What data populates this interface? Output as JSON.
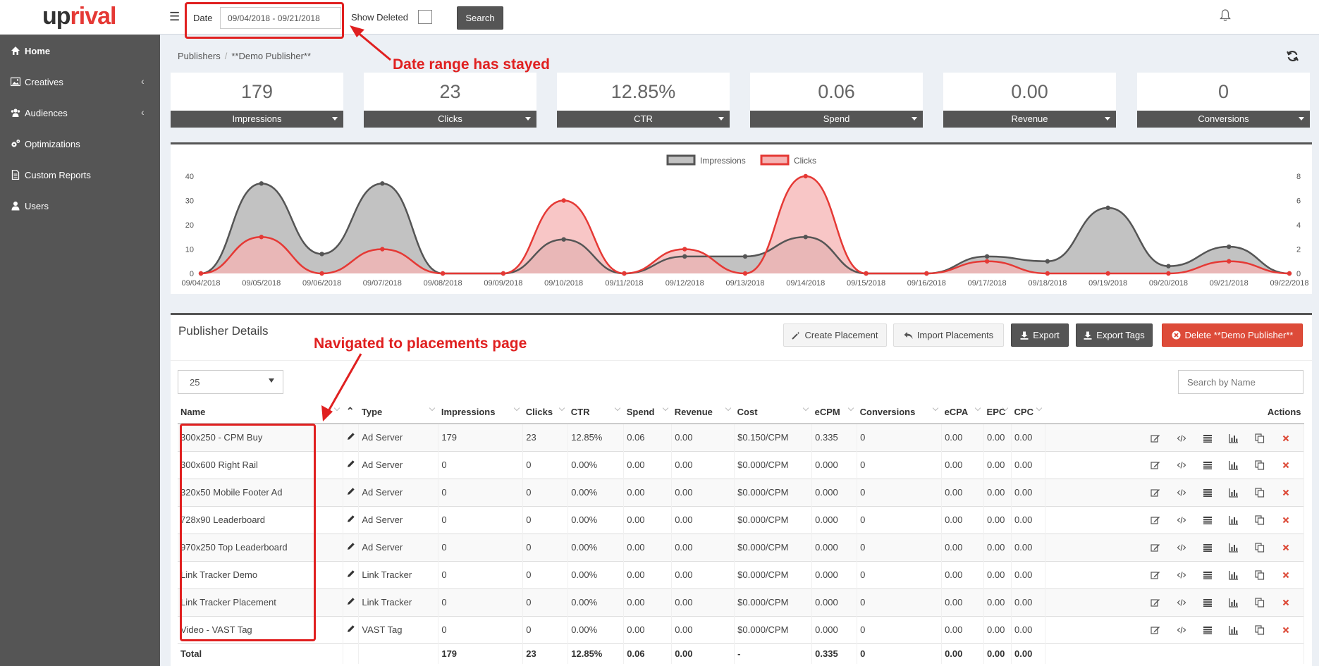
{
  "brand": {
    "logo_up": "up",
    "logo_rival": "rival"
  },
  "toolbar": {
    "date_label": "Date",
    "date_value": "09/04/2018 - 09/21/2018",
    "show_deleted_label": "Show Deleted",
    "search_label": "Search"
  },
  "annotations": {
    "date_note": "Date range has stayed",
    "nav_note": "Navigated to placements page"
  },
  "sidebar": {
    "items": [
      {
        "label": "Home",
        "icon": "home-icon",
        "has_chevron": false
      },
      {
        "label": "Creatives",
        "icon": "image-icon",
        "has_chevron": true
      },
      {
        "label": "Audiences",
        "icon": "users-icon",
        "has_chevron": true
      },
      {
        "label": "Optimizations",
        "icon": "gears-icon",
        "has_chevron": false
      },
      {
        "label": "Custom Reports",
        "icon": "file-icon",
        "has_chevron": false
      },
      {
        "label": "Users",
        "icon": "user-icon",
        "has_chevron": false
      }
    ]
  },
  "breadcrumb": {
    "root": "Publishers",
    "current": "**Demo Publisher**"
  },
  "stats": [
    {
      "value": "179",
      "label": "Impressions"
    },
    {
      "value": "23",
      "label": "Clicks"
    },
    {
      "value": "12.85%",
      "label": "CTR"
    },
    {
      "value": "0.06",
      "label": "Spend"
    },
    {
      "value": "0.00",
      "label": "Revenue"
    },
    {
      "value": "0",
      "label": "Conversions"
    }
  ],
  "chart_data": {
    "type": "area",
    "categories": [
      "09/04/2018",
      "09/05/2018",
      "09/06/2018",
      "09/07/2018",
      "09/08/2018",
      "09/09/2018",
      "09/10/2018",
      "09/11/2018",
      "09/12/2018",
      "09/13/2018",
      "09/14/2018",
      "09/15/2018",
      "09/16/2018",
      "09/17/2018",
      "09/18/2018",
      "09/19/2018",
      "09/20/2018",
      "09/21/2018",
      "09/22/2018"
    ],
    "series": [
      {
        "name": "Impressions",
        "axis": "left",
        "color": "#555555",
        "fill": "#c2c2c2",
        "values": [
          0,
          37,
          8,
          37,
          0,
          0,
          14,
          0,
          7,
          7,
          15,
          0,
          0,
          7,
          5,
          27,
          3,
          11,
          0
        ]
      },
      {
        "name": "Clicks",
        "axis": "right",
        "color": "#e53935",
        "fill": "#f5b3b3",
        "values": [
          0,
          3,
          0,
          2,
          0,
          0,
          6,
          0,
          2,
          0,
          8,
          0,
          0,
          1,
          0,
          0,
          0,
          1,
          0
        ]
      }
    ],
    "y_left": {
      "ticks": [
        0,
        10,
        20,
        30,
        40
      ],
      "ylim": [
        0,
        40
      ]
    },
    "y_right": {
      "ticks": [
        0,
        2,
        4,
        6,
        8
      ],
      "ylim": [
        0,
        8
      ]
    },
    "legend": "top-center"
  },
  "details": {
    "title": "Publisher Details",
    "buttons": {
      "create": "Create Placement",
      "import": "Import Placements",
      "export": "Export",
      "export_tags": "Export Tags",
      "delete": "Delete **Demo Publisher**"
    },
    "page_size": "25",
    "search_placeholder": "Search by Name",
    "columns": [
      "Name",
      "",
      "Type",
      "Impressions",
      "Clicks",
      "CTR",
      "Spend",
      "Revenue",
      "Cost",
      "eCPM",
      "Conversions",
      "eCPA",
      "EPC",
      "CPC",
      "Actions"
    ],
    "rows": [
      {
        "name": "300x250 - CPM Buy",
        "type": "Ad Server",
        "impressions": "179",
        "clicks": "23",
        "ctr": "12.85%",
        "spend": "0.06",
        "revenue": "0.00",
        "cost": "$0.150/CPM",
        "ecpm": "0.335",
        "conversions": "0",
        "ecpa": "0.00",
        "epc": "0.00",
        "cpc": "0.00"
      },
      {
        "name": "300x600 Right Rail",
        "type": "Ad Server",
        "impressions": "0",
        "clicks": "0",
        "ctr": "0.00%",
        "spend": "0.00",
        "revenue": "0.00",
        "cost": "$0.000/CPM",
        "ecpm": "0.000",
        "conversions": "0",
        "ecpa": "0.00",
        "epc": "0.00",
        "cpc": "0.00"
      },
      {
        "name": "320x50 Mobile Footer Ad",
        "type": "Ad Server",
        "impressions": "0",
        "clicks": "0",
        "ctr": "0.00%",
        "spend": "0.00",
        "revenue": "0.00",
        "cost": "$0.000/CPM",
        "ecpm": "0.000",
        "conversions": "0",
        "ecpa": "0.00",
        "epc": "0.00",
        "cpc": "0.00"
      },
      {
        "name": "728x90 Leaderboard",
        "type": "Ad Server",
        "impressions": "0",
        "clicks": "0",
        "ctr": "0.00%",
        "spend": "0.00",
        "revenue": "0.00",
        "cost": "$0.000/CPM",
        "ecpm": "0.000",
        "conversions": "0",
        "ecpa": "0.00",
        "epc": "0.00",
        "cpc": "0.00"
      },
      {
        "name": "970x250 Top Leaderboard",
        "type": "Ad Server",
        "impressions": "0",
        "clicks": "0",
        "ctr": "0.00%",
        "spend": "0.00",
        "revenue": "0.00",
        "cost": "$0.000/CPM",
        "ecpm": "0.000",
        "conversions": "0",
        "ecpa": "0.00",
        "epc": "0.00",
        "cpc": "0.00"
      },
      {
        "name": "Link Tracker Demo",
        "type": "Link Tracker",
        "impressions": "0",
        "clicks": "0",
        "ctr": "0.00%",
        "spend": "0.00",
        "revenue": "0.00",
        "cost": "$0.000/CPM",
        "ecpm": "0.000",
        "conversions": "0",
        "ecpa": "0.00",
        "epc": "0.00",
        "cpc": "0.00"
      },
      {
        "name": "Link Tracker Placement",
        "type": "Link Tracker",
        "impressions": "0",
        "clicks": "0",
        "ctr": "0.00%",
        "spend": "0.00",
        "revenue": "0.00",
        "cost": "$0.000/CPM",
        "ecpm": "0.000",
        "conversions": "0",
        "ecpa": "0.00",
        "epc": "0.00",
        "cpc": "0.00"
      },
      {
        "name": "Video - VAST Tag",
        "type": "VAST Tag",
        "impressions": "0",
        "clicks": "0",
        "ctr": "0.00%",
        "spend": "0.00",
        "revenue": "0.00",
        "cost": "$0.000/CPM",
        "ecpm": "0.000",
        "conversions": "0",
        "ecpa": "0.00",
        "epc": "0.00",
        "cpc": "0.00"
      }
    ],
    "total": {
      "label": "Total",
      "impressions": "179",
      "clicks": "23",
      "ctr": "12.85%",
      "spend": "0.06",
      "revenue": "0.00",
      "cost": "-",
      "ecpm": "0.335",
      "conversions": "0",
      "ecpa": "0.00",
      "epc": "0.00",
      "cpc": "0.00"
    },
    "row_actions": [
      "edit-icon",
      "code-icon",
      "list-icon",
      "bar-chart-icon",
      "copy-icon",
      "delete-icon"
    ]
  },
  "colors": {
    "sidebar": "#555555",
    "accent_red": "#dd4b39",
    "annotation": "#e02020"
  }
}
